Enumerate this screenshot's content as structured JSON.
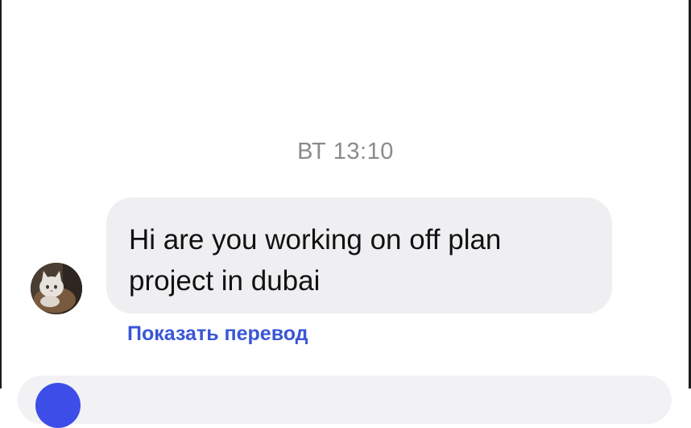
{
  "chat": {
    "timestamp": "ВТ 13:10",
    "message": {
      "text": "Hi are you working on off plan\nproject in dubai",
      "translation_link": "Показать перевод"
    }
  },
  "colors": {
    "bubble_background": "#efeff2",
    "link": "#3a56d6",
    "timestamp": "#8a8a8f",
    "composer_button": "#3d4ee8"
  },
  "icons": {
    "avatar": "cat-photo-avatar"
  }
}
